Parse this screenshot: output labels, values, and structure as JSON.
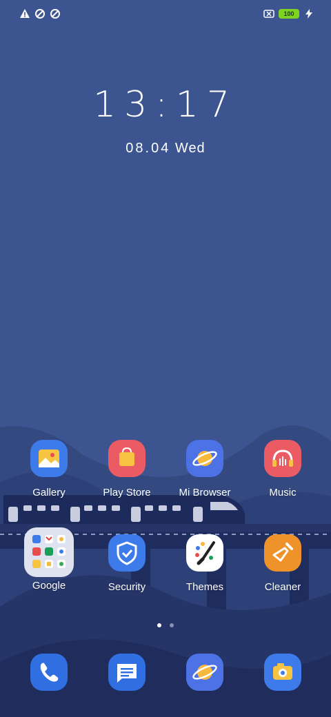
{
  "status_bar": {
    "icons_left": [
      "warning-icon",
      "data-saver-icon",
      "data-saver-icon"
    ],
    "battery": "100",
    "icons_right": [
      "sim-off-icon",
      "battery-icon",
      "charging-icon"
    ]
  },
  "lockscreen": {
    "time": "13:17",
    "date_digits": "08.04",
    "weekday": "Wed"
  },
  "apps_row1": [
    {
      "label": "Gallery"
    },
    {
      "label": "Play Store"
    },
    {
      "label": "Mi Browser"
    },
    {
      "label": "Music"
    }
  ],
  "apps_row2": [
    {
      "label": "Google"
    },
    {
      "label": "Security"
    },
    {
      "label": "Themes"
    },
    {
      "label": "Cleaner"
    }
  ],
  "dock": [
    "phone-icon",
    "messages-icon",
    "browser-icon",
    "camera-icon"
  ],
  "page_indicator": {
    "pages": 2,
    "active": 1
  },
  "colors": {
    "background": "#3c5490",
    "dark_hills": "#2a3a70",
    "train": "#1d2a5c"
  }
}
